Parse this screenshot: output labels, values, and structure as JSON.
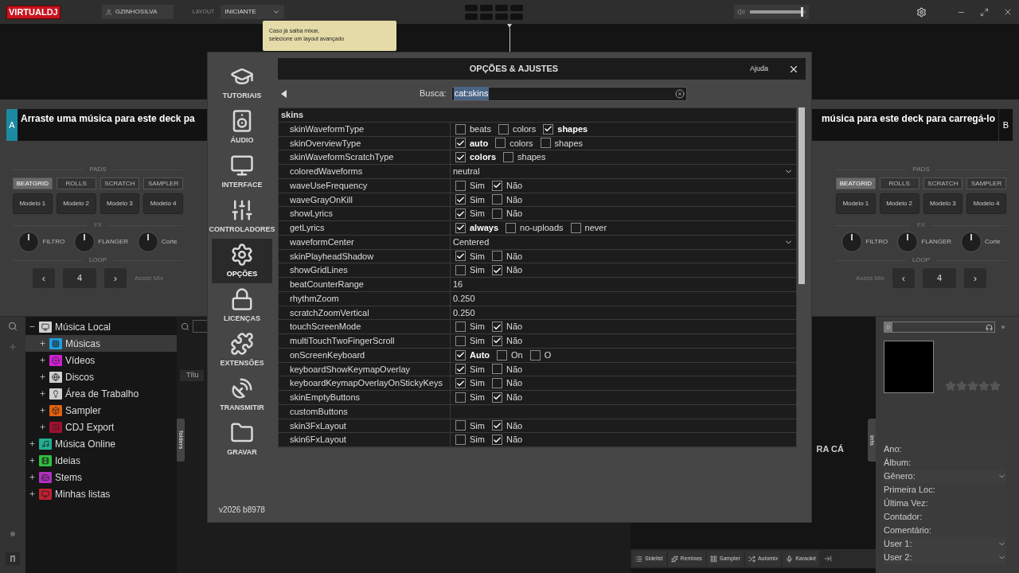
{
  "topbar": {
    "logo": {
      "part1": "VIRTUAL",
      "part2": "DJ"
    },
    "user": "GZINHOSILVA",
    "layout_label": "LAYOUT",
    "layout_value": "INICIANTE",
    "volume": {
      "level": 0.95
    }
  },
  "tooltip": "Caso já saiba mixar,\nselecione um layout avançado",
  "decks": [
    {
      "letter": "A",
      "message": "Arraste uma música para este deck pa",
      "pads_label": "PADS",
      "pad_tabs": [
        {
          "label": "BEATGRID",
          "selected": true
        },
        {
          "label": "ROLLS",
          "selected": false
        },
        {
          "label": "SCRATCH",
          "selected": false
        },
        {
          "label": "SAMPLER",
          "selected": false
        }
      ],
      "pads": [
        "Modelo 1",
        "Modelo 2",
        "Modelo 3",
        "Modelo 4"
      ],
      "fx_label": "FX",
      "fx": [
        "FILTRO",
        "FLANGER",
        "Corte"
      ],
      "loop_label": "LOOP",
      "loop_prev": "‹",
      "loop_value": "4",
      "loop_next": "›",
      "assist": "Assist Mix"
    },
    {
      "letter": "B",
      "message": "música para este deck para carregá-lo",
      "pads_label": "PADS",
      "pad_tabs": [
        {
          "label": "BEATGRID",
          "selected": true
        },
        {
          "label": "ROLLS",
          "selected": false
        },
        {
          "label": "SCRATCH",
          "selected": false
        },
        {
          "label": "SAMPLER",
          "selected": false
        }
      ],
      "pads": [
        "Modelo 1",
        "Modelo 2",
        "Modelo 3",
        "Modelo 4"
      ],
      "fx_label": "FX",
      "fx": [
        "FILTRO",
        "FLANGER",
        "Corte"
      ],
      "loop_label": "LOOP",
      "loop_prev": "‹",
      "loop_value": "4",
      "loop_next": "›",
      "assist": "Assist Mix"
    }
  ],
  "browser": {
    "tree": [
      {
        "label": "Música Local",
        "color": "#d0d0d0",
        "expanded": true,
        "selected": false,
        "children": [
          {
            "label": "Músicas",
            "color": "#1e9fe0",
            "expanded": false,
            "selected": true
          },
          {
            "label": "Vídeos",
            "color": "#d020d0",
            "expanded": false,
            "selected": false
          },
          {
            "label": "Discos",
            "color": "#d0d0d0",
            "expanded": false,
            "selected": false
          },
          {
            "label": "Área de Trabalho",
            "color": "#d0d0d0",
            "expanded": false,
            "selected": false
          },
          {
            "label": "Sampler",
            "color": "#e06010",
            "expanded": false,
            "selected": false
          },
          {
            "label": "CDJ Export",
            "color": "#a01030",
            "expanded": false,
            "selected": false
          }
        ]
      },
      {
        "label": "Música Online",
        "color": "#20b090",
        "expanded": false,
        "selected": false
      },
      {
        "label": "Ideias",
        "color": "#30c040",
        "expanded": false,
        "selected": false
      },
      {
        "label": "Stems",
        "color": "#b030c0",
        "expanded": false,
        "selected": false
      },
      {
        "label": "Minhas listas",
        "color": "#c02030",
        "expanded": false,
        "selected": false
      }
    ],
    "folders_tab": "folders",
    "column_1": "Títu",
    "drop_text": "RA CÁ",
    "info_tab": "info",
    "bottom_buttons": [
      "Sidelist",
      "Remixes",
      "Sampler",
      "Automix",
      "Karaokê"
    ],
    "stars": 0,
    "info_fields": [
      {
        "label": "Ano:",
        "dropdown": false
      },
      {
        "label": "Álbum:",
        "dropdown": false
      },
      {
        "label": "Gênero:",
        "dropdown": true
      },
      {
        "label": "Primeira Loc:",
        "dropdown": false
      },
      {
        "label": "Última Vez:",
        "dropdown": false
      },
      {
        "label": "Contador:",
        "dropdown": false
      },
      {
        "label": "Comentário:",
        "dropdown": false
      },
      {
        "label": "User 1:",
        "dropdown": true
      },
      {
        "label": "User 2:",
        "dropdown": true
      }
    ]
  },
  "dialog": {
    "title": "OPÇÕES & AJUSTES",
    "help": "Ajuda",
    "version": "v2026 b8978",
    "nav": [
      {
        "label": "TUTORIAIS",
        "selected": false
      },
      {
        "label": "ÁUDIO",
        "selected": false
      },
      {
        "label": "INTERFACE",
        "selected": false
      },
      {
        "label": "CONTROLADORES",
        "selected": false
      },
      {
        "label": "OPÇÕES",
        "selected": true
      },
      {
        "label": "LICENÇAS",
        "selected": false
      },
      {
        "label": "EXTENSÕES",
        "selected": false
      },
      {
        "label": "TRANSMITIR",
        "selected": false
      },
      {
        "label": "GRAVAR",
        "selected": false
      }
    ],
    "search": {
      "label": "Busca:",
      "value": "cat:skins"
    },
    "group": "skins",
    "settings": [
      {
        "name": "skinWaveformType",
        "kind": "checks",
        "options": [
          {
            "label": "beats",
            "checked": false,
            "bold": false
          },
          {
            "label": "colors",
            "checked": false,
            "bold": false
          },
          {
            "label": "shapes",
            "checked": true,
            "bold": true
          }
        ]
      },
      {
        "name": "skinOverviewType",
        "kind": "checks",
        "options": [
          {
            "label": "auto",
            "checked": true,
            "bold": true
          },
          {
            "label": "colors",
            "checked": false,
            "bold": false
          },
          {
            "label": "shapes",
            "checked": false,
            "bold": false
          }
        ]
      },
      {
        "name": "skinWaveformScratchType",
        "kind": "checks",
        "options": [
          {
            "label": "colors",
            "checked": true,
            "bold": true
          },
          {
            "label": "shapes",
            "checked": false,
            "bold": false
          }
        ]
      },
      {
        "name": "coloredWaveforms",
        "kind": "select",
        "value": "neutral"
      },
      {
        "name": "waveUseFrequency",
        "kind": "checks",
        "options": [
          {
            "label": "Sim",
            "checked": false,
            "bold": false
          },
          {
            "label": "Não",
            "checked": true,
            "bold": false
          }
        ]
      },
      {
        "name": "waveGrayOnKill",
        "kind": "checks",
        "options": [
          {
            "label": "Sim",
            "checked": true,
            "bold": false
          },
          {
            "label": "Não",
            "checked": false,
            "bold": false
          }
        ]
      },
      {
        "name": "showLyrics",
        "kind": "checks",
        "options": [
          {
            "label": "Sim",
            "checked": true,
            "bold": false
          },
          {
            "label": "Não",
            "checked": false,
            "bold": false
          }
        ]
      },
      {
        "name": "getLyrics",
        "kind": "checks",
        "options": [
          {
            "label": "always",
            "checked": true,
            "bold": true
          },
          {
            "label": "no-uploads",
            "checked": false,
            "bold": false
          },
          {
            "label": "never",
            "checked": false,
            "bold": false
          }
        ]
      },
      {
        "name": "waveformCenter",
        "kind": "select",
        "value": "Centered"
      },
      {
        "name": "skinPlayheadShadow",
        "kind": "checks",
        "options": [
          {
            "label": "Sim",
            "checked": true,
            "bold": false
          },
          {
            "label": "Não",
            "checked": false,
            "bold": false
          }
        ]
      },
      {
        "name": "showGridLines",
        "kind": "checks",
        "options": [
          {
            "label": "Sim",
            "checked": false,
            "bold": false
          },
          {
            "label": "Não",
            "checked": true,
            "bold": false
          }
        ]
      },
      {
        "name": "beatCounterRange",
        "kind": "text",
        "value": "16"
      },
      {
        "name": "rhythmZoom",
        "kind": "text",
        "value": "0.250"
      },
      {
        "name": "scratchZoomVertical",
        "kind": "text",
        "value": "0.250"
      },
      {
        "name": "touchScreenMode",
        "kind": "checks",
        "options": [
          {
            "label": "Sim",
            "checked": false,
            "bold": false
          },
          {
            "label": "Não",
            "checked": true,
            "bold": false
          }
        ]
      },
      {
        "name": "multiTouchTwoFingerScroll",
        "kind": "checks",
        "options": [
          {
            "label": "Sim",
            "checked": false,
            "bold": false
          },
          {
            "label": "Não",
            "checked": true,
            "bold": false
          }
        ]
      },
      {
        "name": "onScreenKeyboard",
        "kind": "checks",
        "options": [
          {
            "label": "Auto",
            "checked": true,
            "bold": true
          },
          {
            "label": "On",
            "checked": false,
            "bold": false
          },
          {
            "label": "O",
            "checked": false,
            "bold": false
          }
        ]
      },
      {
        "name": "keyboardShowKeymapOverlay",
        "kind": "checks",
        "options": [
          {
            "label": "Sim",
            "checked": true,
            "bold": false
          },
          {
            "label": "Não",
            "checked": false,
            "bold": false
          }
        ]
      },
      {
        "name": "keyboardKeymapOverlayOnStickyKeys",
        "kind": "checks",
        "options": [
          {
            "label": "Sim",
            "checked": true,
            "bold": false
          },
          {
            "label": "Não",
            "checked": false,
            "bold": false
          }
        ]
      },
      {
        "name": "skinEmptyButtons",
        "kind": "checks",
        "options": [
          {
            "label": "Sim",
            "checked": false,
            "bold": false
          },
          {
            "label": "Não",
            "checked": true,
            "bold": false
          }
        ]
      },
      {
        "name": "customButtons",
        "kind": "empty"
      },
      {
        "name": "skin3FxLayout",
        "kind": "checks",
        "options": [
          {
            "label": "Sim",
            "checked": false,
            "bold": false
          },
          {
            "label": "Não",
            "checked": true,
            "bold": false
          }
        ]
      },
      {
        "name": "skin6FxLayout",
        "kind": "checks",
        "options": [
          {
            "label": "Sim",
            "checked": false,
            "bold": false
          },
          {
            "label": "Não",
            "checked": true,
            "bold": false
          }
        ]
      }
    ]
  }
}
